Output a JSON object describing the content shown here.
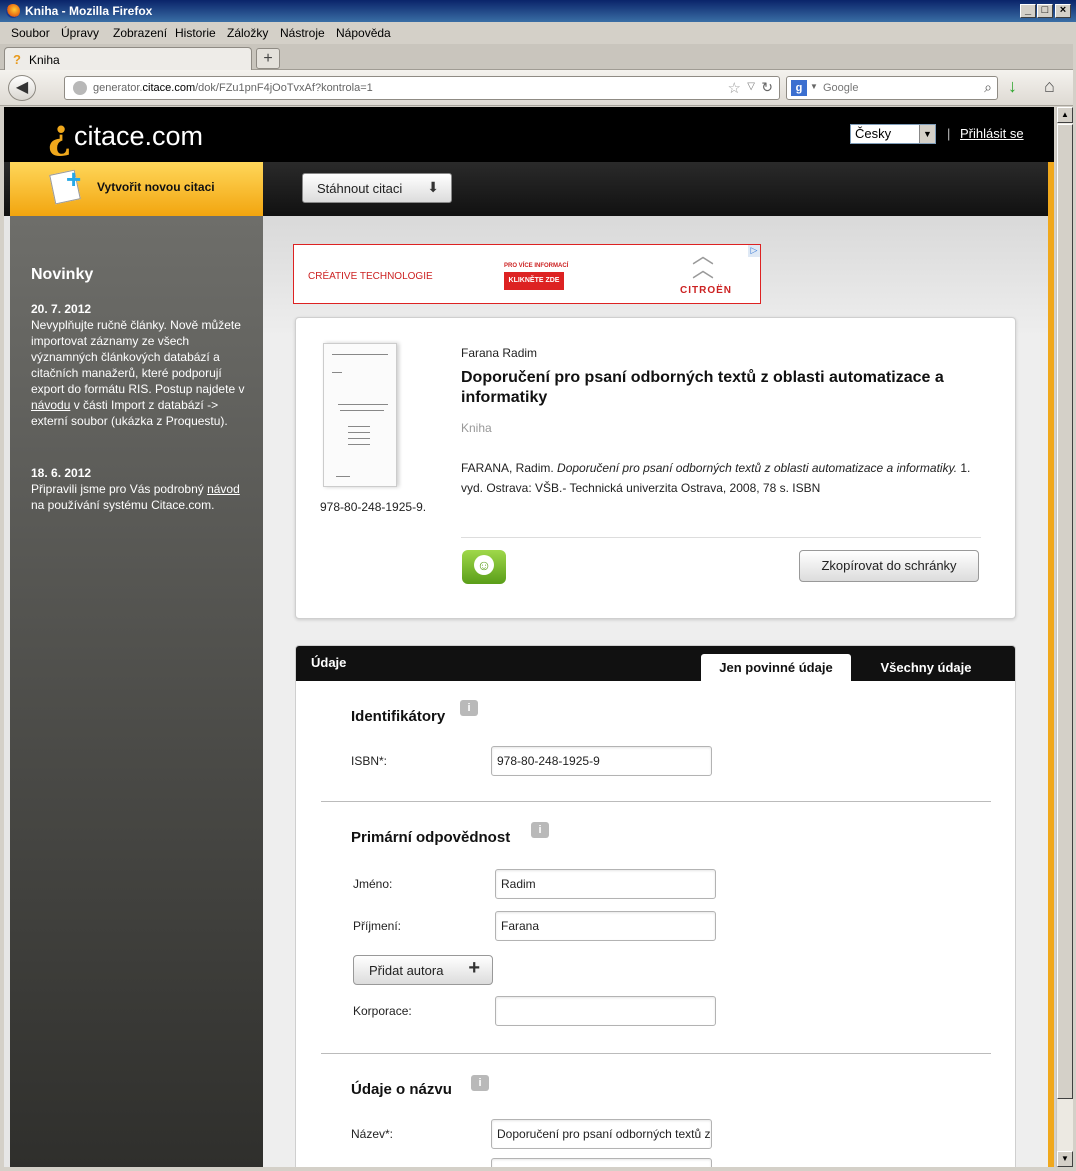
{
  "window": {
    "title": "Kniha - Mozilla Firefox",
    "controls": [
      "_",
      "□",
      "×"
    ]
  },
  "menu": [
    "Soubor",
    "Úpravy",
    "Zobrazení",
    "Historie",
    "Záložky",
    "Nástroje",
    "Nápověda"
  ],
  "tab": {
    "label": "Kniha",
    "new_tab": "+"
  },
  "navbar": {
    "url_prefix": "generator.",
    "url_domain": "citace.com",
    "url_rest": "/dok/FZu1pnF4jOoTvxAf?kontrola=1",
    "search_engine": "g",
    "search_placeholder": "Google"
  },
  "header": {
    "logo_text": "citace.com",
    "language": "Česky",
    "separator": "|",
    "login": "Přihlásit se"
  },
  "toolbar": {
    "create_label": "Vytvořit novou citaci",
    "download_label": "Stáhnout citaci"
  },
  "sidebar": {
    "title": "Novinky",
    "news": [
      {
        "date": "20. 7. 2012",
        "text_before": "Nevyplňujte ručně články. Nově můžete importovat záznamy ze všech významných článkových databází a citačních manažerů, které podporují export do formátu RIS. Postup najdete v ",
        "link": "návodu",
        "text_after": " v části Import z databází -> externí soubor (ukázka z Proquestu)."
      },
      {
        "date": "18. 6. 2012",
        "text_before": "Připravili jsme pro Vás podrobný ",
        "link": "návod",
        "text_after": " na používání systému Citace.com."
      }
    ]
  },
  "ad": {
    "left_text": "CRÉATIVE TECHNOLOGIE",
    "info_text": "PRO VÍCE INFORMACÍ",
    "cta": "KLIKNĚTE ZDE",
    "brand": "CITROËN"
  },
  "book": {
    "cover_caption": "978-80-248-1925-9.",
    "author": "Farana Radim",
    "title": "Doporučení pro psaní odborných textů z oblasti automatizace a informatiky",
    "type": "Kniha",
    "citation_prefix": "FARANA, Radim. ",
    "citation_title": "Doporučení pro psaní odborných textů z oblasti automatizace a informatiky.",
    "citation_suffix": " 1. vyd. Ostrava: VŠB.- Technická univerzita Ostrava, 2008, 78 s. ISBN",
    "copy_button": "Zkopírovat do schránky"
  },
  "form": {
    "title": "Údaje",
    "tabs": {
      "required": "Jen povinné údaje",
      "all": "Všechny údaje"
    },
    "identifiers": {
      "heading": "Identifikátory",
      "isbn_label": "ISBN*:",
      "isbn_value": "978-80-248-1925-9"
    },
    "primary": {
      "heading": "Primární odpovědnost",
      "first_name_label": "Jméno:",
      "first_name_value": "Radim",
      "last_name_label": "Příjmení:",
      "last_name_value": "Farana",
      "add_author": "Přidat autora",
      "corporation_label": "Korporace:",
      "corporation_value": ""
    },
    "title_section": {
      "heading": "Údaje o názvu",
      "name_label": "Název*:",
      "name_value": "Doporučení pro psaní odborných textů z oblasti automatizace a informatiky"
    }
  }
}
